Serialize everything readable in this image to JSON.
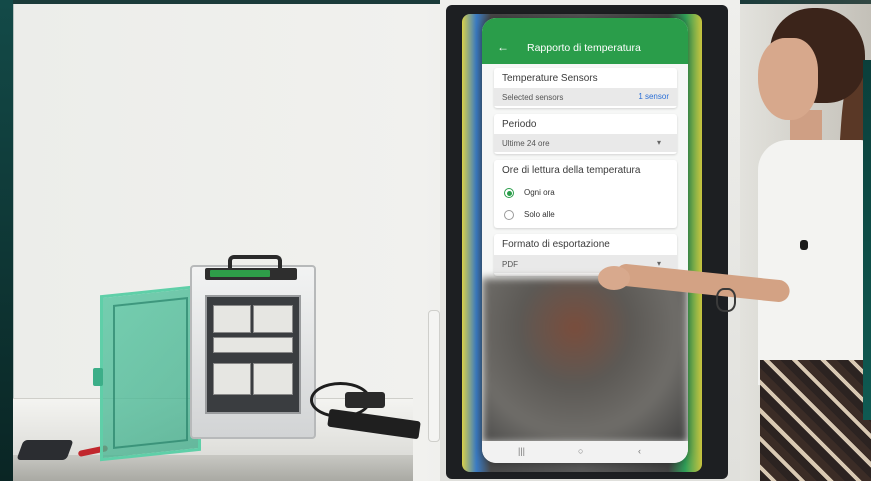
{
  "app": {
    "back_icon": "arrow-left-icon",
    "title": "Rapporto di temperatura"
  },
  "sensors": {
    "heading": "Temperature Sensors",
    "selected_label": "Selected sensors",
    "selected_count": "1 sensor"
  },
  "period": {
    "heading": "Periodo",
    "value": "Ultime 24 ore"
  },
  "reading": {
    "heading": "Ore di lettura della temperatura",
    "options": [
      "Ogni ora",
      "Solo alle"
    ],
    "selected_index": 0
  },
  "export": {
    "heading": "Formato di esportazione",
    "value": "PDF"
  },
  "accent_color": "#2a9d4a"
}
